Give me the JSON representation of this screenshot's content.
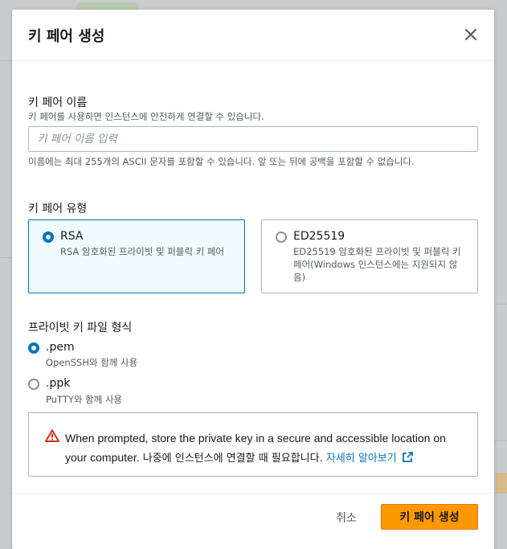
{
  "modal": {
    "title": "키 페어 생성"
  },
  "name_field": {
    "label": "키 페어 이름",
    "description": "키 페어를 사용하면 인스턴스에 안전하게 연결할 수 있습니다.",
    "placeholder": "키 페어 이름 입력",
    "value": "",
    "constraint": "이름에는 최대 255개의 ASCII 문자를 포함할 수 있습니다. 앞 또는 뒤에 공백을 포함할 수 없습니다."
  },
  "type_field": {
    "label": "키 페어 유형",
    "options": [
      {
        "title": "RSA",
        "description": "RSA 암호화된 프라이빗 및 퍼블릭 키 페어",
        "selected": true
      },
      {
        "title": "ED25519",
        "description": "ED25519 암호화된 프라이빗 및 퍼블릭 키 페어(Windows 인스턴스에는 지원되지 않음)",
        "selected": false
      }
    ]
  },
  "format_field": {
    "label": "프라이빗 키 파일 형식",
    "options": [
      {
        "title": ".pem",
        "description": "OpenSSH와 함께 사용",
        "selected": true
      },
      {
        "title": ".ppk",
        "description": "PuTTY와 함께 사용",
        "selected": false
      }
    ]
  },
  "alert": {
    "text_en": "When prompted, store the private key in a secure and accessible location on your computer.",
    "text_ko": "나중에 인스턴스에 연결할 때 필요합니다.",
    "link": "자세히 알아보기"
  },
  "footer": {
    "cancel": "취소",
    "create": "키 페어 생성"
  },
  "colors": {
    "accent": "#0073bb",
    "primary_button": "#ff9900",
    "warning": "#d13212"
  }
}
